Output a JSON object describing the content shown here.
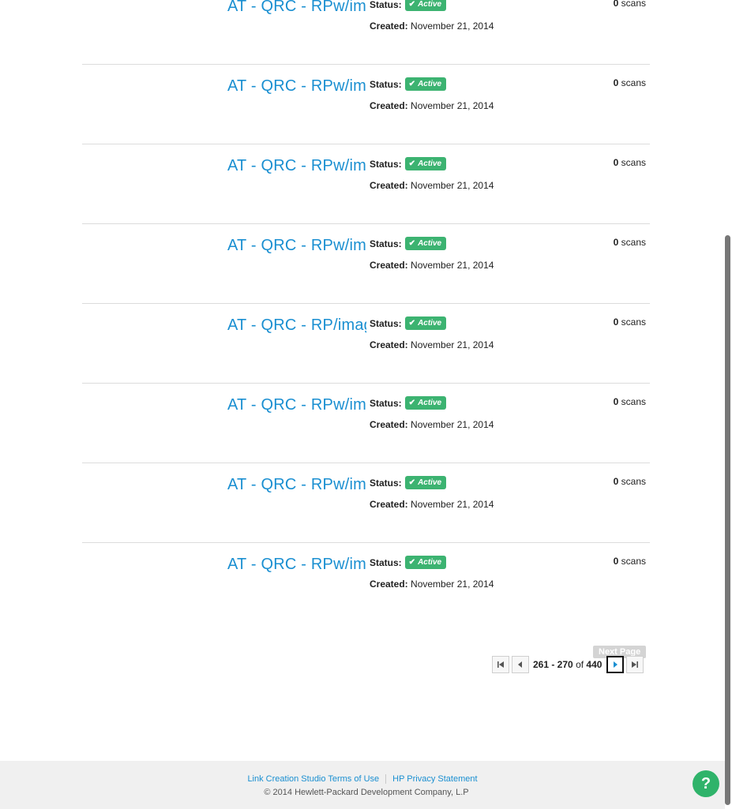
{
  "rows": [
    {
      "title": "AT - QRC - RPw/image",
      "status_label": "Status:",
      "badge": "Active",
      "created_label": "Created:",
      "created": "November 21, 2014",
      "scan_count": "0",
      "scan_unit": "scans"
    },
    {
      "title": "AT - QRC - RPw/image",
      "status_label": "Status:",
      "badge": "Active",
      "created_label": "Created:",
      "created": "November 21, 2014",
      "scan_count": "0",
      "scan_unit": "scans"
    },
    {
      "title": "AT - QRC - RPw/image",
      "status_label": "Status:",
      "badge": "Active",
      "created_label": "Created:",
      "created": "November 21, 2014",
      "scan_count": "0",
      "scan_unit": "scans"
    },
    {
      "title": "AT - QRC - RPw/image",
      "status_label": "Status:",
      "badge": "Active",
      "created_label": "Created:",
      "created": "November 21, 2014",
      "scan_count": "0",
      "scan_unit": "scans"
    },
    {
      "title": "AT - QRC - RP/image",
      "status_label": "Status:",
      "badge": "Active",
      "created_label": "Created:",
      "created": "November 21, 2014",
      "scan_count": "0",
      "scan_unit": "scans"
    },
    {
      "title": "AT - QRC - RPw/image",
      "status_label": "Status:",
      "badge": "Active",
      "created_label": "Created:",
      "created": "November 21, 2014",
      "scan_count": "0",
      "scan_unit": "scans"
    },
    {
      "title": "AT - QRC - RPw/image",
      "status_label": "Status:",
      "badge": "Active",
      "created_label": "Created:",
      "created": "November 21, 2014",
      "scan_count": "0",
      "scan_unit": "scans"
    },
    {
      "title": "AT - QRC - RPw/image",
      "status_label": "Status:",
      "badge": "Active",
      "created_label": "Created:",
      "created": "November 21, 2014",
      "scan_count": "0",
      "scan_unit": "scans"
    }
  ],
  "pager": {
    "range": "261 - 270",
    "of": "of",
    "total": "440",
    "tooltip": "Next Page"
  },
  "footer": {
    "terms_link": "Link Creation Studio Terms of Use",
    "privacy_link": "HP Privacy Statement",
    "copyright": "© 2014 Hewlett-Packard Development Company, L.P"
  },
  "help": {
    "label": "?"
  },
  "colors": {
    "link": "#1a8fd1",
    "badge": "#3cb371",
    "help": "#2fb36a"
  }
}
